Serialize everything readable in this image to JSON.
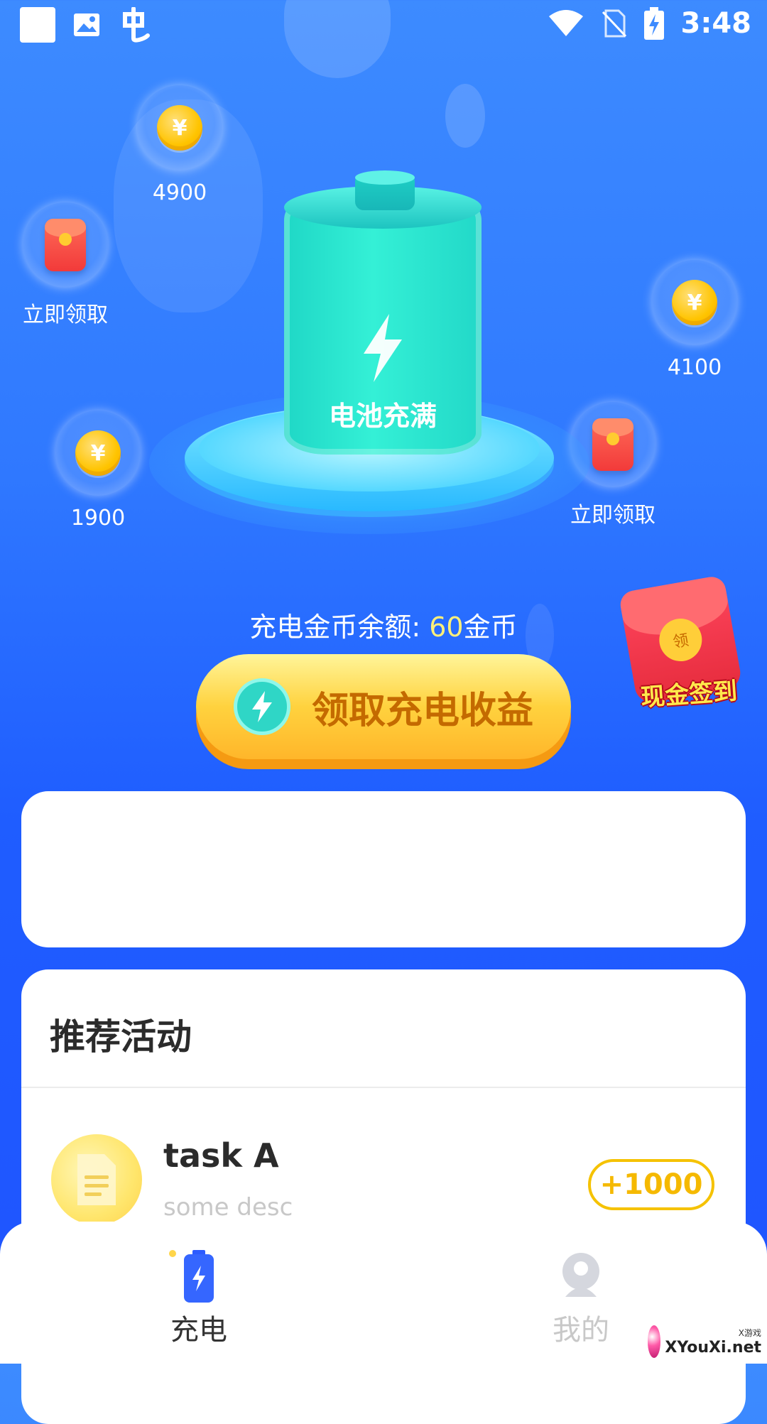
{
  "status_bar": {
    "time": "3:48",
    "left_icons": [
      "notification-square-icon",
      "image-icon",
      "app-icon"
    ],
    "right_icons": [
      "wifi-icon",
      "no-sim-icon",
      "battery-charging-icon"
    ]
  },
  "bubbles": [
    {
      "type": "coin",
      "label": "4900"
    },
    {
      "type": "envelope",
      "label": "立即领取"
    },
    {
      "type": "coin",
      "label": "4100"
    },
    {
      "type": "coin",
      "label": "1900"
    },
    {
      "type": "envelope",
      "label": "立即领取"
    }
  ],
  "battery": {
    "label": "电池充满",
    "level_percent": 100
  },
  "balance": {
    "prefix": "充电金币余额: ",
    "amount": "60",
    "unit": "金币"
  },
  "claim_button": {
    "label": "领取充电收益"
  },
  "cash_signin": {
    "seal": "领",
    "label": "现金签到"
  },
  "activities": {
    "title": "推荐活动",
    "tasks": [
      {
        "title": "task A",
        "desc": "some desc",
        "reward": "+1000"
      }
    ]
  },
  "bottom_nav": {
    "items": [
      {
        "label": "充电",
        "icon": "battery-charge-icon",
        "active": true
      },
      {
        "label": "我的",
        "icon": "user-icon",
        "active": false
      }
    ]
  },
  "watermark": {
    "text": "XYouXi.net",
    "small_text": "X游戏"
  },
  "colors": {
    "background_top": "#3d8bff",
    "background_bottom": "#1f54ff",
    "accent_yellow": "#ffd23e",
    "battery_teal": "#2fe6d2",
    "reward_yellow": "#f5b900"
  }
}
